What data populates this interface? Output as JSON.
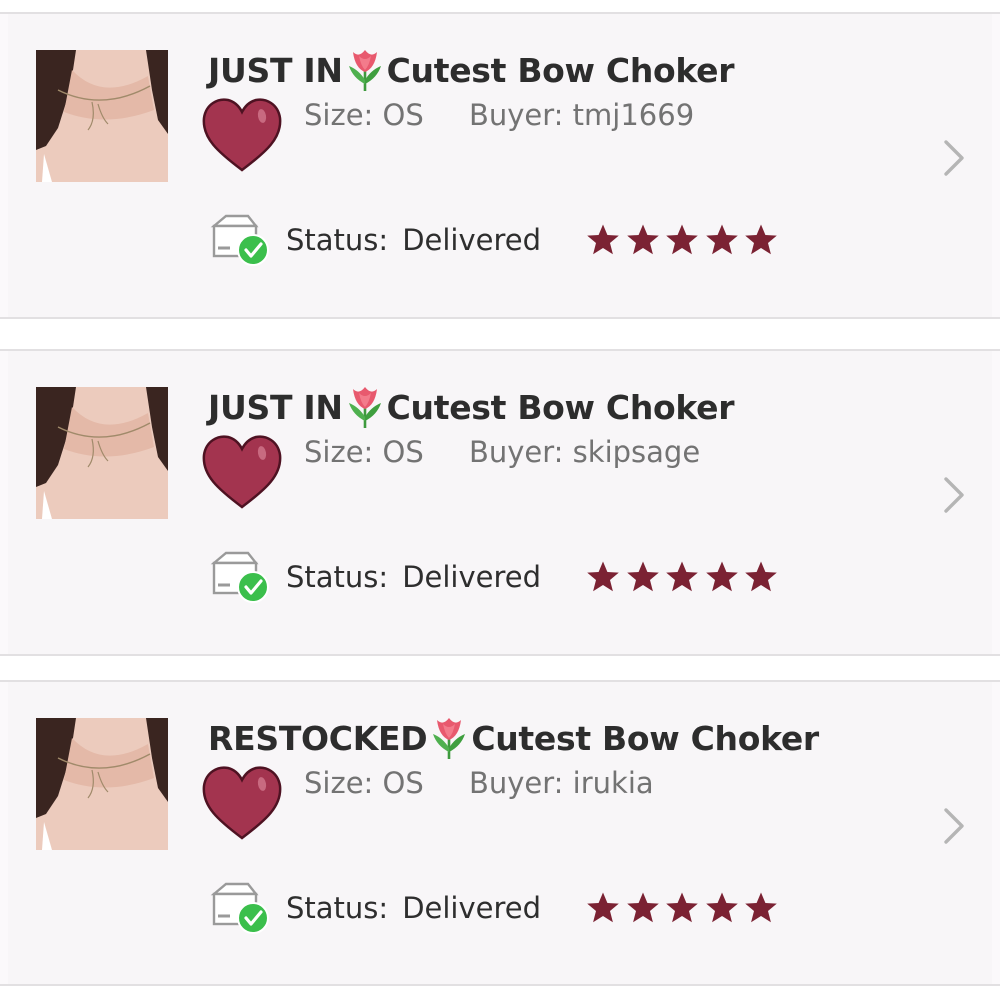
{
  "orders": [
    {
      "title_prefix": "JUST IN",
      "title_suffix": "Cutest Bow Choker",
      "size": "Size: OS",
      "buyer": "Buyer: tmj1669",
      "status_label": "Status:",
      "status_value": "Delivered",
      "rating": 5
    },
    {
      "title_prefix": "JUST IN",
      "title_suffix": "Cutest Bow Choker",
      "size": "Size: OS",
      "buyer": "Buyer: skipsage",
      "status_label": "Status:",
      "status_value": "Delivered",
      "rating": 5
    },
    {
      "title_prefix": "RESTOCKED",
      "title_suffix": "Cutest Bow Choker",
      "size": "Size: OS",
      "buyer": "Buyer: irukia",
      "status_label": "Status:",
      "status_value": "Delivered",
      "rating": 5
    }
  ],
  "icons": {
    "thumbnail": "product-photo-choker",
    "title_emoji": "tulip-emoji-icon",
    "heart": "red-heart-emoji-icon",
    "status": "delivered-box-check-icon",
    "star": "star-icon",
    "chevron": "chevron-right-icon"
  },
  "colors": {
    "star": "#7b2233",
    "heart": "#a0334f",
    "check": "#3bbf4c",
    "title": "#2d2d2d",
    "meta": "#737373",
    "chevron": "#b5b5b5"
  }
}
